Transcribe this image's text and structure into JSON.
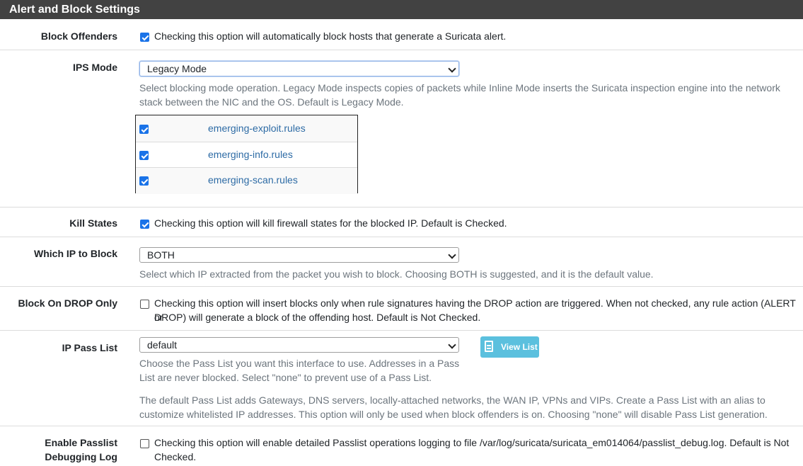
{
  "panel": {
    "title": "Alert and Block Settings"
  },
  "block_offenders": {
    "label": "Block Offenders",
    "checked": true,
    "text": "Checking this option will automatically block hosts that generate a Suricata alert."
  },
  "ips_mode": {
    "label": "IPS Mode",
    "value": "Legacy Mode",
    "help_line1": "Select blocking mode operation. Legacy Mode inspects copies of packets while Inline Mode inserts the Suricata inspection engine into the network",
    "help_line2": "stack between the NIC and the OS. Default is Legacy Mode.",
    "rules": [
      {
        "name": "emerging-exploit.rules",
        "checked": true
      },
      {
        "name": "emerging-info.rules",
        "checked": true
      },
      {
        "name": "emerging-scan.rules",
        "checked": true
      }
    ]
  },
  "kill_states": {
    "label": "Kill States",
    "checked": true,
    "text": "Checking this option will kill firewall states for the blocked IP. Default is Checked."
  },
  "which_ip": {
    "label": "Which IP to Block",
    "value": "BOTH",
    "help": "Select which IP extracted from the packet you wish to block. Choosing BOTH is suggested, and it is the default value."
  },
  "block_drop": {
    "label": "Block On DROP Only",
    "checked": false,
    "text_line1": "Checking this option will insert blocks only when rule signatures having the DROP action are triggered. When not checked, any rule action (ALERT or",
    "text_line2": "DROP) will generate a block of the offending host. Default is Not Checked."
  },
  "pass_list": {
    "label": "IP Pass List",
    "value": "default",
    "button": "View List",
    "help_line1": "Choose the Pass List you want this interface to use. Addresses in a Pass",
    "help_line2": "List are never blocked. Select \"none\" to prevent use of a Pass List.",
    "note_line1": "The default Pass List adds Gateways, DNS servers, locally-attached networks, the WAN IP, VPNs and VIPs. Create a Pass List with an alias to",
    "note_line2": "customize whitelisted IP addresses. This option will only be used when block offenders is on. Choosing \"none\" will disable Pass List generation."
  },
  "passlist_debug": {
    "label_line1": "Enable Passlist",
    "label_line2": "Debugging Log",
    "checked": false,
    "text_line1": "Checking this option will enable detailed Passlist operations logging to file /var/log/suricata/suricata_em014064/passlist_debug.log. Default is Not",
    "text_line2": "Checked."
  }
}
